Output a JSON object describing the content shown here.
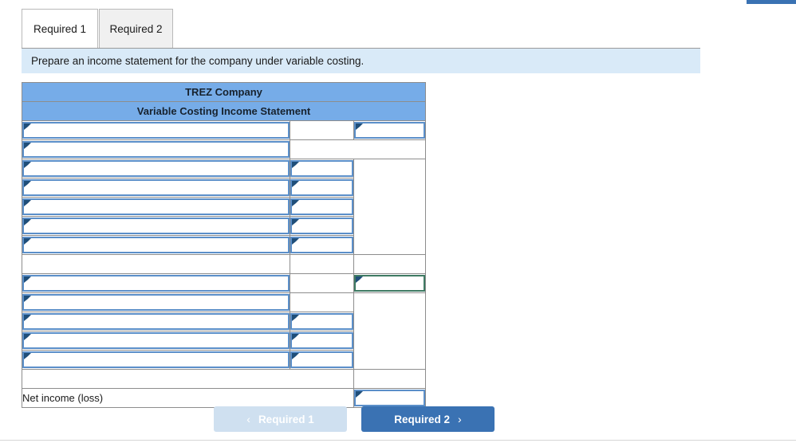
{
  "tabs": [
    {
      "label": "Required 1",
      "active": true
    },
    {
      "label": "Required 2",
      "active": false
    }
  ],
  "instruction": "Prepare an income statement for the company under variable costing.",
  "worksheet": {
    "title_line_1": "TREZ  Company",
    "title_line_2": "Variable Costing Income Statement",
    "net_income_label": "Net income (loss)",
    "rows": [
      {
        "type": "input-row",
        "col1": "",
        "col2": "",
        "col3": ""
      },
      {
        "type": "input-row",
        "col1": "",
        "col2": "",
        "col3": ""
      },
      {
        "type": "input-row",
        "col1": "",
        "col2": "",
        "col3": ""
      },
      {
        "type": "input-row",
        "col1": "",
        "col2": "",
        "col3": ""
      },
      {
        "type": "input-row",
        "col1": "",
        "col2": "",
        "col3": ""
      },
      {
        "type": "input-row",
        "col1": "",
        "col2": "",
        "col3": ""
      },
      {
        "type": "input-row",
        "col1": "",
        "col2": "",
        "col3": ""
      },
      {
        "type": "spacer-row",
        "col1": "",
        "col2": "",
        "col3": ""
      },
      {
        "type": "input-row",
        "col1": "",
        "col2": "",
        "col3": ""
      },
      {
        "type": "input-row",
        "col1": "",
        "col2": "",
        "col3": ""
      },
      {
        "type": "input-row",
        "col1": "",
        "col2": "",
        "col3": ""
      },
      {
        "type": "input-row",
        "col1": "",
        "col2": "",
        "col3": ""
      },
      {
        "type": "input-row",
        "col1": "",
        "col2": "",
        "col3": ""
      },
      {
        "type": "spacer-row",
        "col1": "",
        "col2": "",
        "col3": ""
      },
      {
        "type": "net-income-row",
        "col1": "Net income (loss)",
        "col2": "",
        "col3": ""
      }
    ]
  },
  "nav": {
    "prev_label": "Required 1",
    "prev_chevron": "chevron-left-icon",
    "prev_chevron_glyph": "‹",
    "next_label": "Required 2",
    "next_chevron": "chevron-right-icon",
    "next_chevron_glyph": "›"
  },
  "colors": {
    "header_blue": "#76ace8",
    "instruction_blue": "#d9eaf8",
    "field_border": "#5b8fc9",
    "field_border_green": "#3e7a63",
    "primary_button": "#3a72b3",
    "disabled_button": "#cfe0f0"
  }
}
